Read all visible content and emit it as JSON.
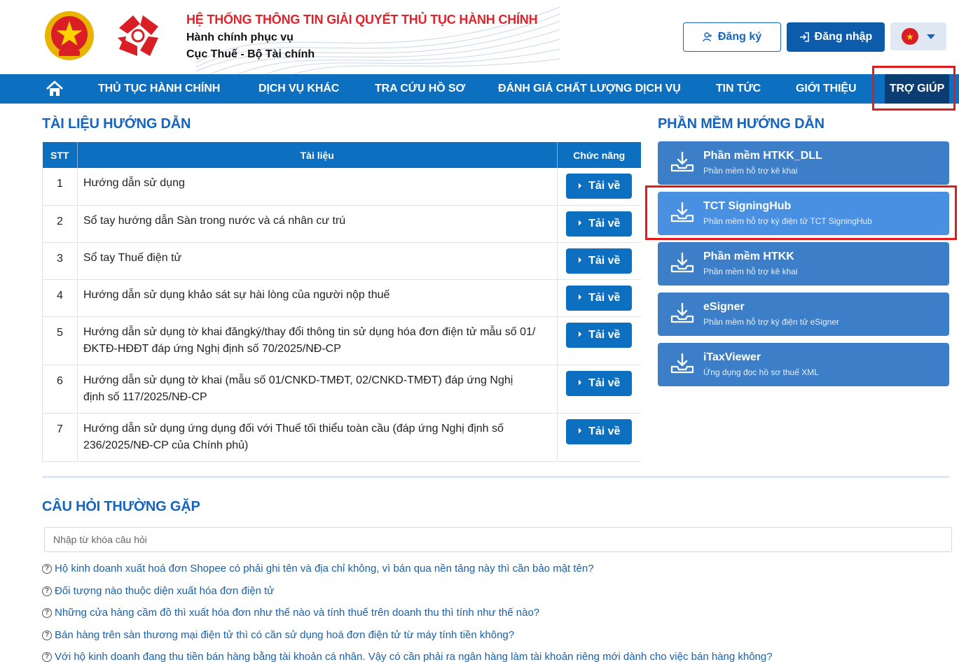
{
  "header": {
    "title": "HỆ THỐNG THÔNG TIN GIẢI QUYẾT THỦ TỤC HÀNH CHÍNH",
    "subtitle1": "Hành chính phục vụ",
    "subtitle2": "Cục Thuế - Bộ Tài chính",
    "register_label": "Đăng ký",
    "login_label": "Đăng nhập",
    "language_icon": "vietnam-flag-icon"
  },
  "nav": {
    "items": [
      {
        "label": "THỦ TỤC HÀNH CHÍNH"
      },
      {
        "label": "DỊCH VỤ KHÁC"
      },
      {
        "label": "TRA CỨU HỒ SƠ"
      },
      {
        "label": "ĐÁNH GIÁ CHẤT LƯỢNG DỊCH VỤ"
      },
      {
        "label": "TIN TỨC"
      },
      {
        "label": "GIỚI THIỆU"
      }
    ],
    "active_label": "TRỢ GIÚP"
  },
  "docs": {
    "title": "TÀI LIỆU HƯỚNG DẪN",
    "columns": [
      "STT",
      "Tài liệu",
      "Chức năng"
    ],
    "download_label": "Tải về",
    "rows": [
      {
        "stt": "1",
        "name": "Hướng dẫn sử dụng"
      },
      {
        "stt": "2",
        "name": "Sổ tay hướng dẫn Sàn trong nước và cá nhân cư trú"
      },
      {
        "stt": "3",
        "name": "Sổ tay Thuế điện tử"
      },
      {
        "stt": "4",
        "name": "Hướng dẫn sử dụng khảo sát sự hài lòng của người nộp thuế"
      },
      {
        "stt": "5",
        "name": "Hướng dẫn sử dụng tờ khai đăngký/thay đổi thông tin sử dụng hóa đơn điện tử mẫu số 01/ĐKTĐ-HĐĐT đáp ứng Nghị định số 70/2025/NĐ-CP"
      },
      {
        "stt": "6",
        "name": "Hướng dẫn sử dụng tờ khai (mẫu số 01/CNKD-TMĐT, 02/CNKD-TMĐT) đáp ứng Nghị định số 117/2025/NĐ-CP"
      },
      {
        "stt": "7",
        "name": "Hướng dẫn sử dụng ứng dụng đối với Thuế tối thiểu toàn cầu (đáp ứng Nghị định số 236/2025/NĐ-CP của Chính phủ)"
      }
    ]
  },
  "software": {
    "title": "PHẦN MỀM HƯỚNG DẪN",
    "items": [
      {
        "name": "Phần mềm HTKK_DLL",
        "desc": "Phần mềm hỗ trợ kê khai"
      },
      {
        "name": "TCT SigningHub",
        "desc": "Phần mềm hỗ trợ ký điện tử TCT SigningHub"
      },
      {
        "name": "Phần mềm HTKK",
        "desc": "Phần mềm hỗ trợ kê khai"
      },
      {
        "name": "eSigner",
        "desc": "Phần mềm hỗ trợ ký điện tử eSigner"
      },
      {
        "name": "iTaxViewer",
        "desc": "Ứng dụng đọc hồ sơ thuế XML"
      }
    ]
  },
  "faq": {
    "title": "CÂU HỎI THƯỜNG GẶP",
    "search_placeholder": "Nhập từ khóa câu hỏi",
    "questions": [
      "Hộ kinh doanh xuất hoá đơn Shopee có phải ghi tên và địa chỉ không, vì bán qua nền tảng này thì cần bảo mật tên?",
      "Đối tượng nào thuộc diện xuất hóa đơn điện tử",
      "Những cửa hàng cầm đồ thì xuất hóa đơn như thế nào và tính thuế trên doanh thu thì tính như thế nào?",
      "Bán hàng trên sàn thương mại điện tử thì có cần sử dụng hoá đơn điện tử từ máy tính tiền không?",
      "Với hộ kinh doanh đang thu tiền bán hàng bằng tài khoản cá nhân. Vậy có cần phải ra ngân hàng làm tài khoản riêng mới dành cho việc bán hàng không?"
    ]
  },
  "colors": {
    "primary": "#0d6fc0",
    "nav_active": "#0b3d73",
    "title_red": "#e0242b",
    "highlight": "#e01b1b"
  }
}
